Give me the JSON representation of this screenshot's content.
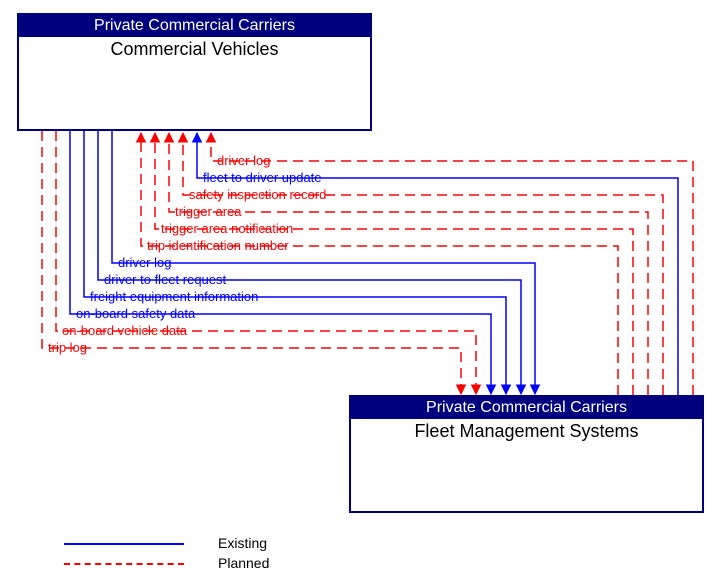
{
  "boxes": {
    "top": {
      "header": "Private Commercial Carriers",
      "title": "Commercial Vehicles"
    },
    "bottom": {
      "header": "Private Commercial Carriers",
      "title": "Fleet Management Systems"
    }
  },
  "flows": [
    {
      "label": "driver log",
      "status": "planned",
      "direction": "to_top"
    },
    {
      "label": "fleet to driver update",
      "status": "existing",
      "direction": "to_top"
    },
    {
      "label": "safety inspection record",
      "status": "planned",
      "direction": "to_top"
    },
    {
      "label": "trigger area",
      "status": "planned",
      "direction": "to_top"
    },
    {
      "label": "trigger area notification",
      "status": "planned",
      "direction": "to_top"
    },
    {
      "label": "trip identification number",
      "status": "planned",
      "direction": "to_top"
    },
    {
      "label": "driver log",
      "status": "existing",
      "direction": "to_bottom"
    },
    {
      "label": "driver to fleet request",
      "status": "existing",
      "direction": "to_bottom"
    },
    {
      "label": "freight equipment information",
      "status": "existing",
      "direction": "to_bottom"
    },
    {
      "label": "on-board safety data",
      "status": "existing",
      "direction": "to_bottom"
    },
    {
      "label": "on-board vehicle data",
      "status": "planned",
      "direction": "to_bottom"
    },
    {
      "label": "trip log",
      "status": "planned",
      "direction": "to_bottom"
    }
  ],
  "legend": {
    "existing": "Existing",
    "planned": "Planned"
  },
  "colors": {
    "existing": "#0000ff",
    "planned": "#ff0000"
  }
}
